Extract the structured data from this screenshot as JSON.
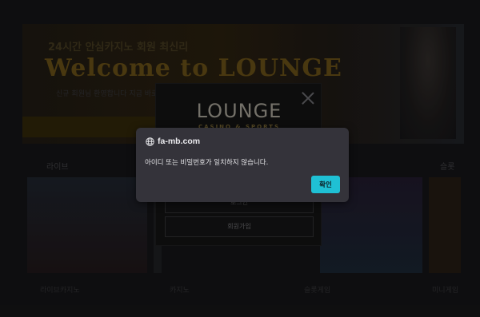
{
  "background": {
    "hero_subtitle": "24시간 안심카지노 회원 최신리",
    "hero_title": "Welcome to LOUNGE",
    "hero_description": "신규 회원님 환영합니다 지금 바로 라운지와 함께하세요",
    "section_left_label": "라이브",
    "section_right_label": "슬롯",
    "captions": [
      "라이브카지노",
      "카지노",
      "슬롯게임",
      "미니게임"
    ]
  },
  "login_modal": {
    "logo_main": "LOUNGE",
    "logo_sub": "CASINO & SPORTS",
    "login_button": "로그인",
    "signup_button": "회원가입"
  },
  "alert": {
    "origin": "fa-mb.com",
    "message": "아이디 또는 비밀번호가 일치하지 않습니다.",
    "ok_button": "확인"
  },
  "colors": {
    "alert_background": "#34333a",
    "ok_button": "#1fc0d4",
    "logo_gold": "#6b5b2e"
  }
}
